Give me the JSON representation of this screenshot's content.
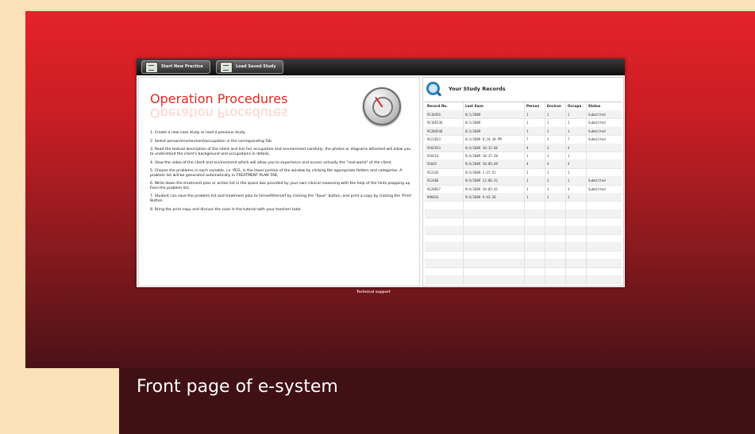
{
  "toolbar": {
    "start_new_label": "Start New Practice",
    "load_saved_label": "Load Saved Study"
  },
  "procedures": {
    "title": "Operation Procedures",
    "steps": [
      "1. Create a new case study or load a previous study.",
      "2. Select person/environment/occupation in the corresponding Tab",
      "3. Read the textual description of the client and his/ her occupation and environment carefully, the photos or diagrams attached will allow you to understand the client's background and occupations in details,",
      "4. View the video of the client and environment which will allow you to experience and access virtually the \"real-world\" of the client.",
      "5. Choose the problems in each variable, i.e. PEO, in the lower portion of the window by clicking the appropriate folders and categories. A problem list will be generated automatically in TREATMENT PLAN TAB,",
      "6. Write down the treatment plan or action list in the space box provided by your own clinical reasoning with the help of the hints propping up from the problem list,",
      "7. Student can save the problem list and treatment plan to himself/herself by clicking the \"Save\" button, and print a copy by clicking the 'Print' Button.",
      "8. Bring the print copy and discuss the case in the tutorial with your teacher/ tutor."
    ]
  },
  "records": {
    "title": "Your Study Records",
    "headers": [
      "Record No.",
      "Last Save",
      "Person",
      "Environ",
      "Occupa",
      "Status"
    ],
    "rows": [
      [
        "9118456",
        "8/1/2009",
        "1",
        "1",
        "1",
        "Submitted"
      ],
      [
        "91185536",
        "8/1/2009",
        "1",
        "1",
        "1",
        "Submitted"
      ],
      [
        "91204548",
        "8/1/2009",
        "1",
        "1",
        "1",
        "Submitted"
      ],
      [
        "9121833",
        "8/1/2009 8:24:10 PM",
        "7",
        "3",
        "7",
        "Submitted"
      ],
      [
        "9101933",
        "9/4/2009 10:32:06",
        "4",
        "3",
        "4",
        ""
      ],
      [
        "910314",
        "9/4/2009 10:37:20",
        "1",
        "1",
        "1",
        ""
      ],
      [
        "91045",
        "9/4/2009 10:09:09",
        "4",
        "4",
        "4",
        ""
      ],
      [
        "912343",
        "9/4/2009 1:37:52",
        "1",
        "1",
        "1",
        ""
      ],
      [
        "912466",
        "9/4/2009 12:06:32",
        "1",
        "3",
        "1",
        "Submitted"
      ],
      [
        "9120037",
        "9/4/2009 10:03:42",
        "3",
        "1",
        "3",
        "Submitted"
      ],
      [
        "996816",
        "9/4/2009 9:43:20",
        "1",
        "1",
        "1",
        ""
      ]
    ]
  },
  "footer": {
    "tech_support": "Technical support"
  },
  "caption": "Front page of e-system"
}
